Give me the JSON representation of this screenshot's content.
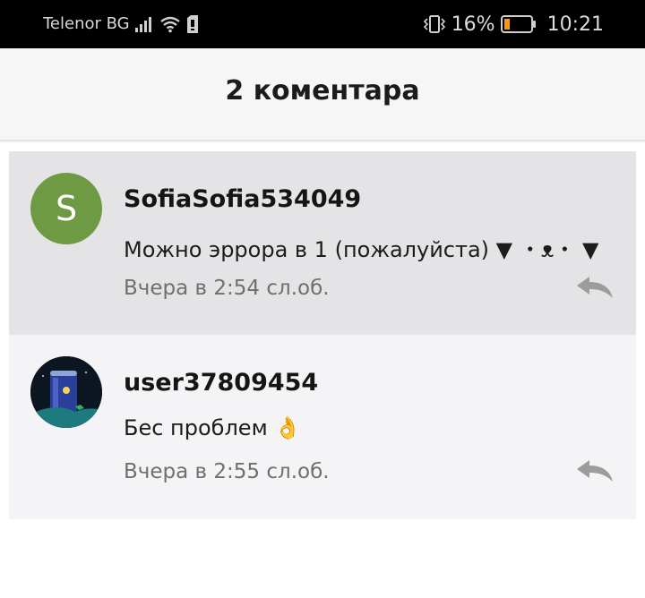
{
  "status_bar": {
    "carrier": "Telenor BG",
    "battery_percent": "16%",
    "clock": "10:21",
    "icons": [
      "signal-icon",
      "wifi-icon",
      "sim-icon",
      "vibrate-icon",
      "battery-icon"
    ]
  },
  "header": {
    "title": "2 коментара"
  },
  "comments": [
    {
      "username": "SofiaSofia534049",
      "avatar_letter": "S",
      "avatar_color": "#6e9a43",
      "text": "Можно эррора в 1 (пожалуйста) ▼ ・ᴥ・ ▼",
      "time": "Вчера в 2:54 сл.об."
    },
    {
      "username": "user37809454",
      "avatar_icon": "can-avatar-image",
      "text": "Бес проблем 👌",
      "time": "Вчера в 2:55 сл.об."
    }
  ],
  "colors": {
    "highlight_bg": "#e4e4e6",
    "comment_bg": "#f4f3f6",
    "muted_text": "#6f6f6f"
  }
}
